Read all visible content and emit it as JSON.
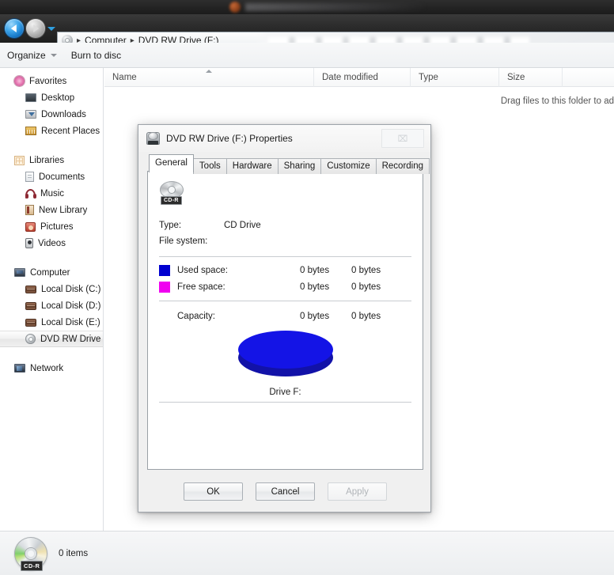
{
  "window": {
    "nav": {
      "back_icon": "back-arrow-icon",
      "forward_icon": "forward-arrow-icon",
      "history_dropdown_icon": "chevron-down-icon",
      "breadcrumbs": [
        "Computer",
        "DVD RW Drive (F:)"
      ],
      "separator": "▸"
    },
    "toolbar": {
      "organize_label": "Organize",
      "burn_label": "Burn to disc"
    }
  },
  "sidebar": {
    "groups": [
      {
        "header": {
          "label": "Favorites",
          "icon": "favorites-star-icon"
        },
        "items": [
          {
            "label": "Desktop",
            "icon": "desktop-icon"
          },
          {
            "label": "Downloads",
            "icon": "downloads-icon"
          },
          {
            "label": "Recent Places",
            "icon": "recent-places-icon"
          }
        ]
      },
      {
        "header": {
          "label": "Libraries",
          "icon": "libraries-icon"
        },
        "items": [
          {
            "label": "Documents",
            "icon": "documents-icon"
          },
          {
            "label": "Music",
            "icon": "music-icon"
          },
          {
            "label": "New Library",
            "icon": "new-library-icon"
          },
          {
            "label": "Pictures",
            "icon": "pictures-icon"
          },
          {
            "label": "Videos",
            "icon": "videos-icon"
          }
        ]
      },
      {
        "header": {
          "label": "Computer",
          "icon": "computer-icon"
        },
        "items": [
          {
            "label": "Local Disk (C:)",
            "icon": "hard-disk-icon"
          },
          {
            "label": "Local Disk (D:)",
            "icon": "hard-disk-icon"
          },
          {
            "label": "Local Disk (E:)",
            "icon": "hard-disk-icon"
          },
          {
            "label": "DVD RW Drive (",
            "icon": "dvd-drive-icon",
            "selected": true
          }
        ]
      },
      {
        "header": {
          "label": "Network",
          "icon": "network-icon"
        },
        "items": []
      }
    ]
  },
  "filelist": {
    "columns": [
      {
        "label": "Name",
        "sorted": "asc"
      },
      {
        "label": "Date modified"
      },
      {
        "label": "Type"
      },
      {
        "label": "Size"
      }
    ],
    "empty_hint": "Drag files to this folder to ad"
  },
  "statusbar": {
    "disc_icon": "cd-r-disc-icon",
    "disc_badge": "CD-R",
    "item_count": "0 items"
  },
  "dialog": {
    "title": "DVD RW Drive (F:) Properties",
    "title_icon": "dvd-drive-icon",
    "close_glyph": "⌧",
    "tabs": [
      {
        "label": "General",
        "active": true
      },
      {
        "label": "Tools",
        "active": false
      },
      {
        "label": "Hardware",
        "active": false
      },
      {
        "label": "Sharing",
        "active": false
      },
      {
        "label": "Customize",
        "active": false
      },
      {
        "label": "Recording",
        "active": false
      }
    ],
    "general": {
      "drive_icon": "cd-r-disc-icon",
      "drive_badge": "CD-R",
      "type_label": "Type:",
      "type_value": "CD Drive",
      "filesystem_label": "File system:",
      "filesystem_value": "",
      "used_label": "Used space:",
      "used_bytes": "0 bytes",
      "used_bytes_alt": "0 bytes",
      "used_color": "#0000D0",
      "free_label": "Free space:",
      "free_bytes": "0 bytes",
      "free_bytes_alt": "0 bytes",
      "free_color": "#F000F0",
      "capacity_label": "Capacity:",
      "capacity_bytes": "0 bytes",
      "capacity_bytes_alt": "0 bytes",
      "pie_caption": "Drive F:"
    },
    "buttons": {
      "ok": "OK",
      "cancel": "Cancel",
      "apply": "Apply"
    }
  },
  "chart_data": {
    "type": "pie",
    "title": "Drive F:",
    "labels": [
      "Used space",
      "Free space"
    ],
    "values": [
      0,
      0
    ],
    "display_fractions": [
      1.0,
      0.0
    ],
    "colors": [
      "#1414E6",
      "#F000F0"
    ],
    "side_colors": [
      "#1212A8",
      "#9000A0"
    ],
    "units": "bytes",
    "legend_position": "above",
    "note": "Capacity 0 bytes; chart renders as a solid blue 3D disc"
  }
}
